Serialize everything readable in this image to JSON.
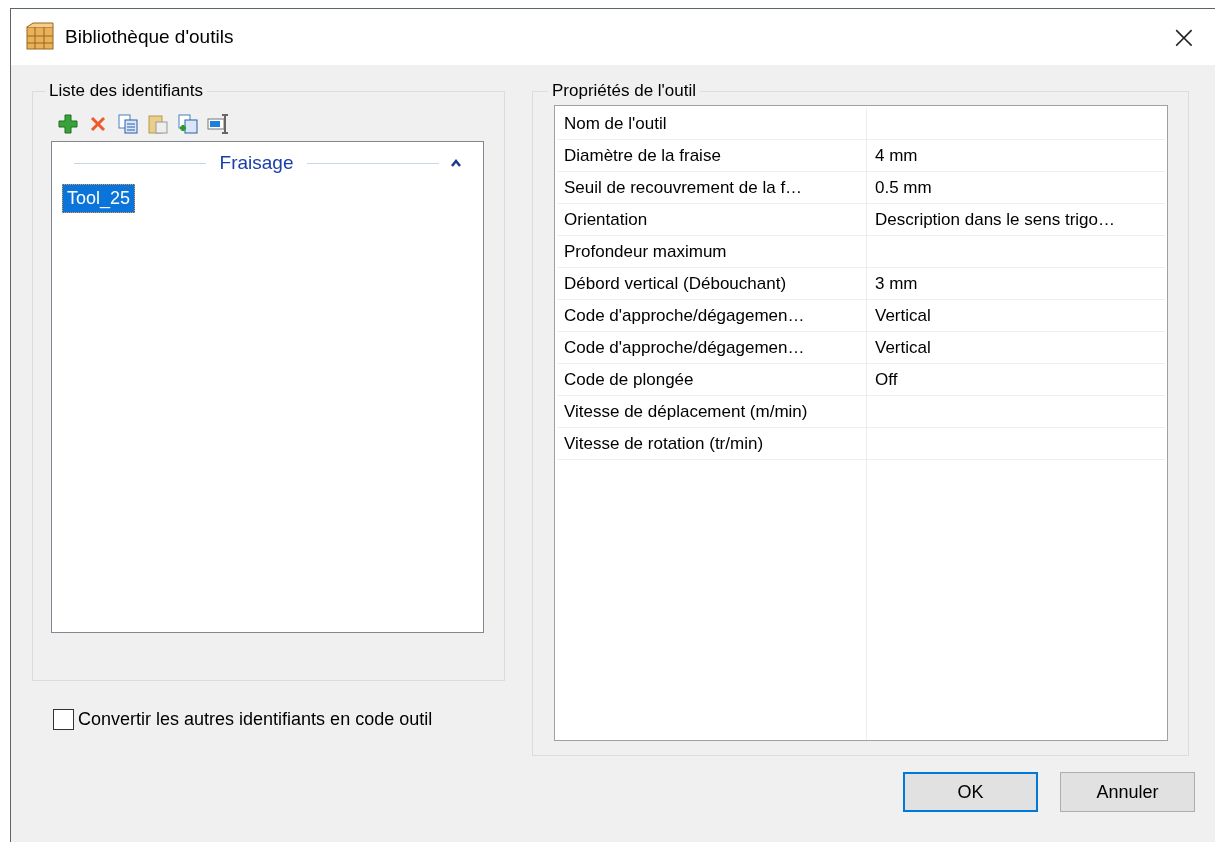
{
  "window": {
    "title": "Bibliothèque d'outils",
    "close": "×"
  },
  "identifiers": {
    "title": "Liste des identifiants",
    "group": {
      "label": "Fraisage",
      "expanded": true
    },
    "items": [
      {
        "label": "Tool_25",
        "selected": true
      }
    ]
  },
  "convert": {
    "label": "Convertir les autres identifiants en code outil",
    "checked": false
  },
  "properties": {
    "title": "Propriétés de l'outil",
    "rows": [
      {
        "name": "Nom de l'outil"
      },
      {
        "name": "Diamètre de la fraise",
        "value": "4 mm"
      },
      {
        "name": "Seuil de recouvrement de la f…",
        "value": "0.5 mm"
      },
      {
        "name": "Orientation",
        "value": "Description dans le sens trigo…"
      },
      {
        "name": "Profondeur maximum"
      },
      {
        "name": "Débord vertical (Débouchant)",
        "value": "3 mm"
      },
      {
        "name": "Code d'approche/dégagemen…",
        "value": "Vertical"
      },
      {
        "name": "Code d'approche/dégagemen…",
        "value": "Vertical"
      },
      {
        "name": "Code de plongée",
        "value": "Off"
      },
      {
        "name": "Vitesse de déplacement (m/min)"
      },
      {
        "name": "Vitesse de rotation (tr/min)"
      }
    ]
  },
  "buttons": [
    {
      "label": "OK",
      "default": true
    },
    {
      "label": "Annuler",
      "default": false
    }
  ]
}
